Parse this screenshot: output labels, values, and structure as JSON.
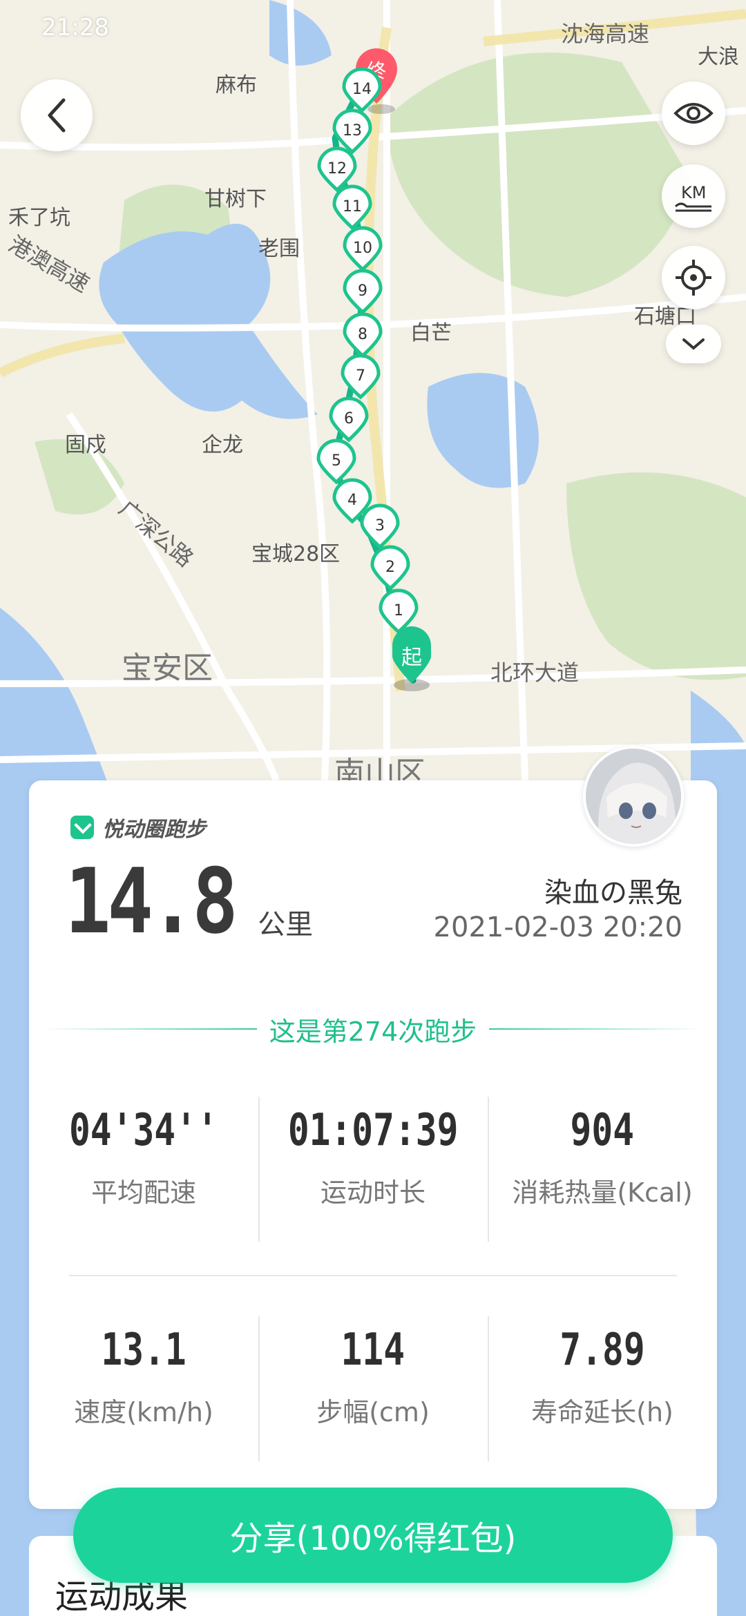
{
  "status_bar": {
    "time": "21:28",
    "right": ""
  },
  "map": {
    "places": [
      "麻布",
      "沈海高速",
      "大浪",
      "禾了坑",
      "甘树下",
      "老围",
      "白芒",
      "石塘口",
      "固戍",
      "企龙",
      "宝城28区",
      "宝安区",
      "北环大道",
      "广深公路",
      "南山区",
      "港澳高速"
    ],
    "start_marker": "起",
    "end_marker": "终",
    "km_markers": [
      "1",
      "2",
      "3",
      "4",
      "5",
      "6",
      "7",
      "8",
      "9",
      "10",
      "11",
      "12",
      "13",
      "14"
    ],
    "route_color": "#17b389",
    "marker_color": "#1ec48d"
  },
  "controls": {
    "back": "back-icon",
    "eye": "eye-icon",
    "km": "KM",
    "locate": "locate-icon",
    "more": "chevron-down-icon"
  },
  "card": {
    "brand": "悦动圈跑步",
    "distance": "14.8",
    "distance_unit": "公里",
    "user_name": "染血の黑兔",
    "datetime": "2021-02-03 20:20",
    "run_count_text": "这是第274次跑步",
    "stats": [
      {
        "value": "04'34''",
        "label": "平均配速"
      },
      {
        "value": "01:07:39",
        "label": "运动时长"
      },
      {
        "value": "904",
        "label": "消耗热量(Kcal)"
      },
      {
        "value": "13.1",
        "label": "速度(km/h)"
      },
      {
        "value": "114",
        "label": "步幅(cm)"
      },
      {
        "value": "7.89",
        "label": "寿命延长(h)"
      }
    ]
  },
  "share_button": "分享(100%得红包)",
  "bottom_section_title": "运动成果",
  "accent_color": "#1dd39c"
}
